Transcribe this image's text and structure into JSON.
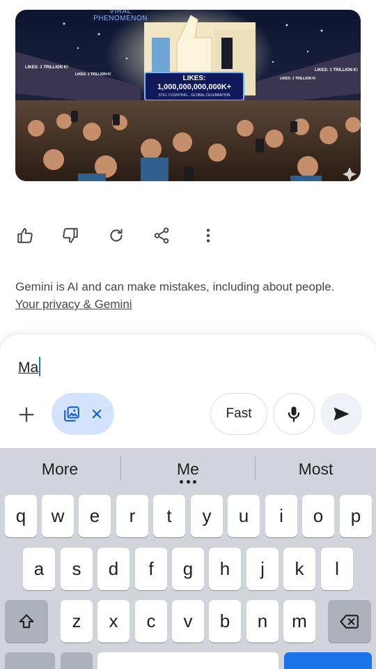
{
  "image": {
    "top_caption": "VIRAL PHENOMENON",
    "screen_line1": "LIKES:",
    "screen_line2": "1,000,000,000,000K+",
    "screen_line3": "STILL COUNTING... GLOBAL CELEBRATION",
    "banner_left": "LIKES: 1 TRILLION K!",
    "banner_left2": "LIKES: 1 TRILLION K!",
    "banner_right": "LIKES: 1 TRILLION K!",
    "banner_right2": "LIKES: 1 TRILLION K!"
  },
  "actions": {
    "icons": [
      "thumb-up-icon",
      "thumb-down-icon",
      "redo-icon",
      "share-icon",
      "more-vert-icon"
    ]
  },
  "disclaimer": {
    "text": "Gemini is AI and can make mistakes, including about people. ",
    "link": "Your privacy & Gemini"
  },
  "composer": {
    "input_value": "Ma",
    "fast_label": "Fast"
  },
  "keyboard": {
    "suggestions": [
      "More",
      "Me",
      "Most"
    ],
    "row1": [
      "q",
      "w",
      "e",
      "r",
      "t",
      "y",
      "u",
      "i",
      "o",
      "p"
    ],
    "row2": [
      "a",
      "s",
      "d",
      "f",
      "g",
      "h",
      "j",
      "k",
      "l"
    ],
    "row3": [
      "z",
      "x",
      "c",
      "v",
      "b",
      "n",
      "m"
    ]
  },
  "colors": {
    "accent": "#1a73e8",
    "chip_bg": "#d3e3fd",
    "keyboard_bg": "#d1d4db"
  }
}
